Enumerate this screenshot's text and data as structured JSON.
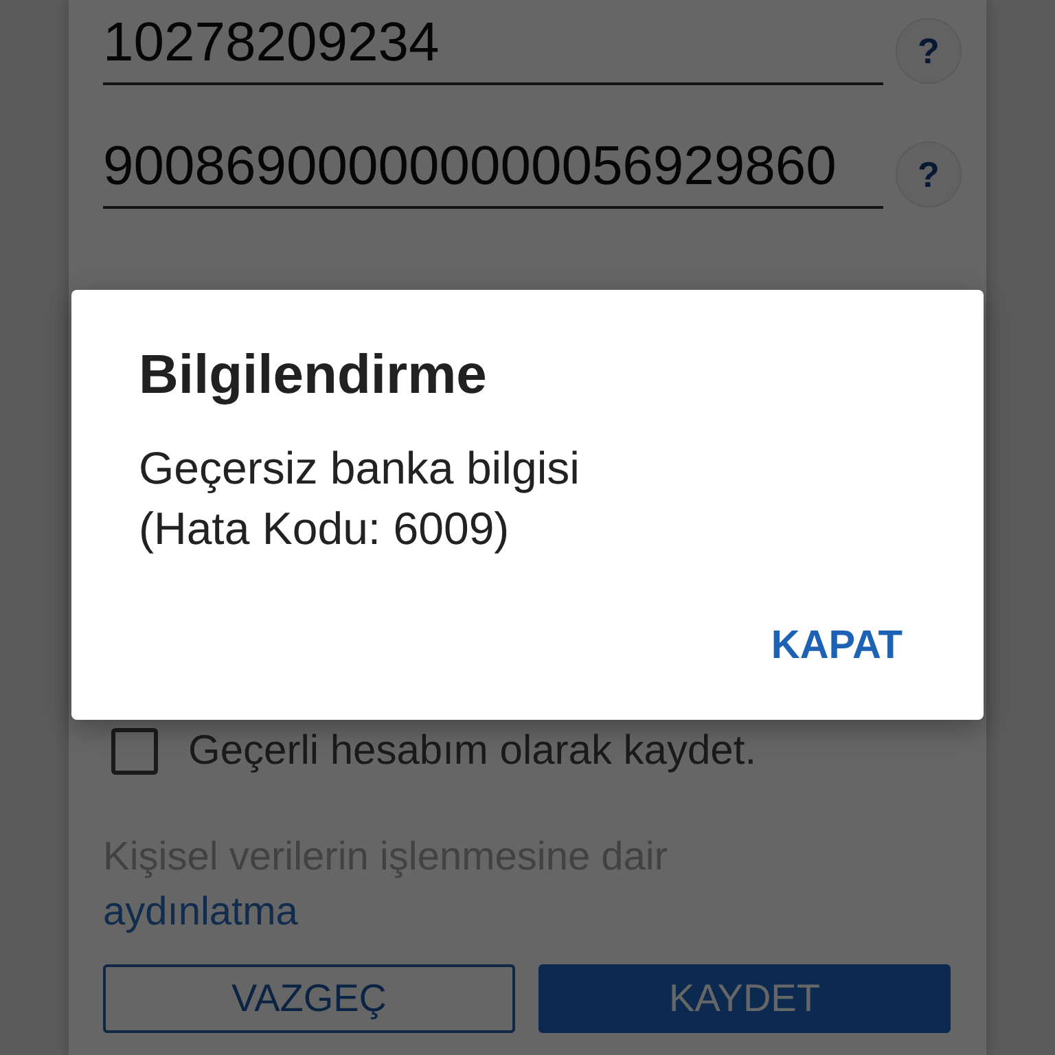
{
  "fields": [
    {
      "value": "10278209234",
      "help": "?"
    },
    {
      "value": "900869000000000056929860",
      "help": "?"
    }
  ],
  "consent": {
    "label": "Geçerli hesabım olarak kaydet.",
    "checked": false
  },
  "privacy_notice": {
    "text": "Kişisel verilerin işlenmesine dair",
    "link": "aydınlatma"
  },
  "buttons": [
    {
      "label": "VAZGEÇ",
      "kind": "outlined"
    },
    {
      "label": "KAYDET",
      "kind": "filled"
    }
  ],
  "dialog": {
    "title": "Bilgilendirme",
    "message": "Geçersiz banka bilgisi\n(Hata Kodu: 6009)",
    "action": "KAPAT"
  }
}
